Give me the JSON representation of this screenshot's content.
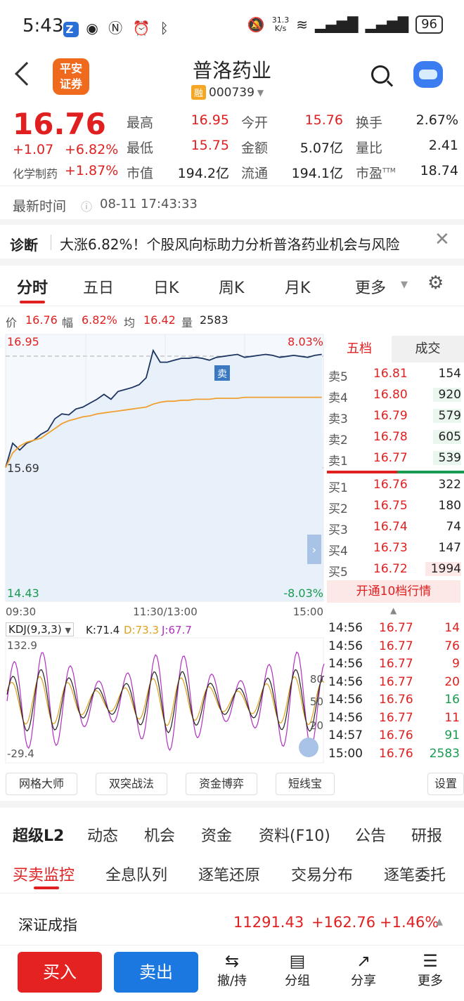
{
  "status": {
    "time": "5:43",
    "netspeed_top": "31.3",
    "netspeed_bottom": "K/s",
    "battery": "96"
  },
  "header": {
    "logo_line1": "平安",
    "logo_line2": "证券",
    "title": "普洛药业",
    "margin_tag": "融",
    "code": "000739"
  },
  "quote": {
    "price": "16.76",
    "change": "+1.07",
    "change_pct": "+6.82%",
    "sector": "化学制药",
    "sector_pct": "+1.87%",
    "labels": {
      "high": "最高",
      "low": "最低",
      "mcap": "市值",
      "open": "今开",
      "amount": "金额",
      "float": "流通",
      "turnover": "换手",
      "vol_ratio": "量比",
      "pe": "市盈",
      "pe_sup": "TTM"
    },
    "values": {
      "high": "16.95",
      "low": "15.75",
      "mcap": "194.2亿",
      "open": "15.76",
      "amount": "5.07亿",
      "float": "194.1亿",
      "turnover": "2.67%",
      "vol_ratio": "2.41",
      "pe": "18.74"
    }
  },
  "timeline": {
    "label": "最新时间",
    "value": "08-11 17:43:33"
  },
  "diagnosis": {
    "label": "诊断",
    "text": "大涨6.82%！个股风向标助力分析普洛药业机会与风险"
  },
  "chart_tabs": [
    "分时",
    "五日",
    "日K",
    "周K",
    "月K",
    "更多"
  ],
  "info_line": {
    "price_k": "价",
    "price_v": "16.76",
    "amp_k": "幅",
    "amp_v": "6.82%",
    "avg_k": "均",
    "avg_v": "16.42",
    "vol_k": "量",
    "vol_v": "2583"
  },
  "chart_labels": {
    "top_left": "16.95",
    "top_right": "8.03%",
    "mid_left": "15.69",
    "bottom_left": "14.43",
    "bottom_right": "-8.03%",
    "t_start": "09:30",
    "t_mid": "11:30/13:00",
    "t_end": "15:00",
    "sell_marker": "卖"
  },
  "chart_data": {
    "type": "line",
    "x": [
      "09:30",
      "11:30/13:00",
      "15:00"
    ],
    "ylim": [
      14.43,
      16.95
    ],
    "series": [
      {
        "name": "价",
        "color": "#1d3560",
        "values": [
          15.7,
          15.95,
          15.88,
          15.95,
          15.98,
          16.04,
          16.08,
          16.2,
          16.25,
          16.24,
          16.3,
          16.32,
          16.36,
          16.4,
          16.45,
          16.4,
          16.48,
          16.5,
          16.52,
          16.55,
          16.62,
          16.9,
          16.78,
          16.78,
          16.8,
          16.82,
          16.82,
          16.83,
          16.82,
          16.8,
          16.83,
          16.84,
          16.85,
          16.86,
          16.83,
          16.84,
          16.85,
          16.86,
          16.85,
          16.83,
          16.84,
          16.85,
          16.84,
          16.83,
          16.85,
          16.86
        ]
      },
      {
        "name": "均",
        "color": "#f0a030",
        "values": [
          15.7,
          15.85,
          15.92,
          15.96,
          15.98,
          16.0,
          16.05,
          16.1,
          16.15,
          16.18,
          16.2,
          16.22,
          16.23,
          16.25,
          16.26,
          16.27,
          16.28,
          16.29,
          16.3,
          16.31,
          16.32,
          16.35,
          16.37,
          16.38,
          16.38,
          16.39,
          16.39,
          16.4,
          16.4,
          16.4,
          16.41,
          16.41,
          16.41,
          16.41,
          16.42,
          16.42,
          16.42,
          16.42,
          16.42,
          16.42,
          16.42,
          16.42,
          16.42,
          16.42,
          16.42,
          16.42
        ]
      }
    ]
  },
  "book": {
    "tab_active": "五档",
    "tab_other": "成交",
    "sells": [
      {
        "l": "卖5",
        "p": "16.81",
        "v": "154"
      },
      {
        "l": "卖4",
        "p": "16.80",
        "v": "920"
      },
      {
        "l": "卖3",
        "p": "16.79",
        "v": "579"
      },
      {
        "l": "卖2",
        "p": "16.78",
        "v": "605"
      },
      {
        "l": "卖1",
        "p": "16.77",
        "v": "539"
      }
    ],
    "buys": [
      {
        "l": "买1",
        "p": "16.76",
        "v": "322"
      },
      {
        "l": "买2",
        "p": "16.75",
        "v": "180"
      },
      {
        "l": "买3",
        "p": "16.74",
        "v": "74"
      },
      {
        "l": "买4",
        "p": "16.73",
        "v": "147"
      },
      {
        "l": "买5",
        "p": "16.72",
        "v": "1994"
      }
    ],
    "open10": "开通10档行情"
  },
  "trades": [
    {
      "t": "14:56",
      "p": "16.77",
      "v": "14"
    },
    {
      "t": "14:56",
      "p": "16.77",
      "v": "76"
    },
    {
      "t": "14:56",
      "p": "16.77",
      "v": "9"
    },
    {
      "t": "14:56",
      "p": "16.77",
      "v": "20"
    },
    {
      "t": "14:56",
      "p": "16.76",
      "v": "16"
    },
    {
      "t": "14:56",
      "p": "16.77",
      "v": "11"
    },
    {
      "t": "14:57",
      "p": "16.76",
      "v": "91"
    },
    {
      "t": "15:00",
      "p": "16.76",
      "v": "2583"
    }
  ],
  "kdj": {
    "name": "KDJ(9,3,3)",
    "k": "K:71.4",
    "d": "D:73.3",
    "j": "J:67.7",
    "top": "132.9",
    "bottom": "-29.4",
    "r80": "80",
    "r50": "50",
    "r20": "20"
  },
  "tools": [
    "网格大师",
    "双突战法",
    "资金博弈",
    "短线宝",
    "设置"
  ],
  "l2tabs": [
    "超级L2",
    "动态",
    "机会",
    "资金",
    "资料(F10)",
    "公告",
    "研报"
  ],
  "subtabs": [
    "买卖监控",
    "全息队列",
    "逐笔还原",
    "交易分布",
    "逐笔委托"
  ],
  "index": {
    "name": "深证成指",
    "value": "11291.43",
    "change": "+162.76",
    "pct": "+1.46%"
  },
  "bottom": {
    "buy": "买入",
    "sell": "卖出",
    "items": [
      "撤/持",
      "分组",
      "分享",
      "更多"
    ]
  }
}
